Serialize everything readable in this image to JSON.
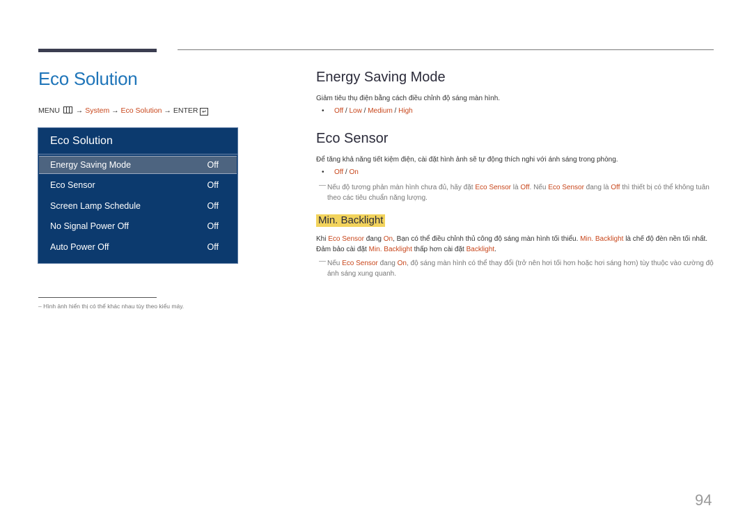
{
  "page": {
    "chapter_title": "Eco Solution",
    "page_number": "94"
  },
  "menu_path": {
    "menu": "MENU",
    "arrow1": " → ",
    "system": "System",
    "arrow2": " → ",
    "eco_solution": "Eco Solution",
    "arrow3": " → ",
    "enter": "ENTER"
  },
  "osd": {
    "title": "Eco Solution",
    "items": [
      {
        "label": "Energy Saving Mode",
        "value": "Off",
        "selected": true
      },
      {
        "label": "Eco Sensor",
        "value": "Off"
      },
      {
        "label": "Screen Lamp Schedule",
        "value": "Off"
      },
      {
        "label": "No Signal Power Off",
        "value": "Off"
      },
      {
        "label": "Auto Power Off",
        "value": "Off"
      }
    ]
  },
  "footnote": "–  Hình ảnh hiển thị có thể khác nhau tùy theo kiểu máy.",
  "energy_saving": {
    "heading": "Energy Saving Mode",
    "description": "Giảm tiêu thụ điện bằng cách điều chỉnh độ sáng màn hình.",
    "options": [
      "Off",
      "Low",
      "Medium",
      "High"
    ],
    "sep": " / "
  },
  "eco_sensor": {
    "heading": "Eco Sensor",
    "description": "Để tăng khả năng tiết kiệm điện, cài đặt hình ảnh sẽ tự động thích nghi với ánh sáng trong phòng.",
    "options": [
      "Off",
      "On"
    ],
    "sep": " / ",
    "note": {
      "t1": "Nếu độ tương phản màn hình chưa đủ, hãy đặt ",
      "h1": "Eco Sensor",
      "t2": " là ",
      "h2": "Off",
      "t3": ". Nếu ",
      "h3": "Eco Sensor",
      "t4": " đang là ",
      "h4": "Off",
      "t5": " thì thiết bị có thể không tuân theo các tiêu chuẩn năng lượng."
    }
  },
  "min_backlight": {
    "heading": "Min. Backlight",
    "para": {
      "t1": "Khi ",
      "h1": "Eco Sensor",
      "t2": " đang ",
      "h2": "On",
      "t3": ", Bạn có thể điều chỉnh thủ công độ sáng màn hình tối thiểu. ",
      "h3": "Min. Backlight",
      "t4": " là chế độ đèn nền tối nhất. Đảm bảo cài đặt ",
      "h4": "Min. Backlight",
      "t5": " thấp hơn cài đặt ",
      "h5": "Backlight",
      "t6": "."
    },
    "note": {
      "t1": "Nếu ",
      "h1": "Eco Sensor",
      "t2": " đang ",
      "h2": "On",
      "t3": ", độ sáng màn hình có thể thay đổi (trở nên hơi tối hơn hoặc hơi sáng hơn) tùy thuộc vào cường độ ánh sáng xung quanh."
    }
  }
}
